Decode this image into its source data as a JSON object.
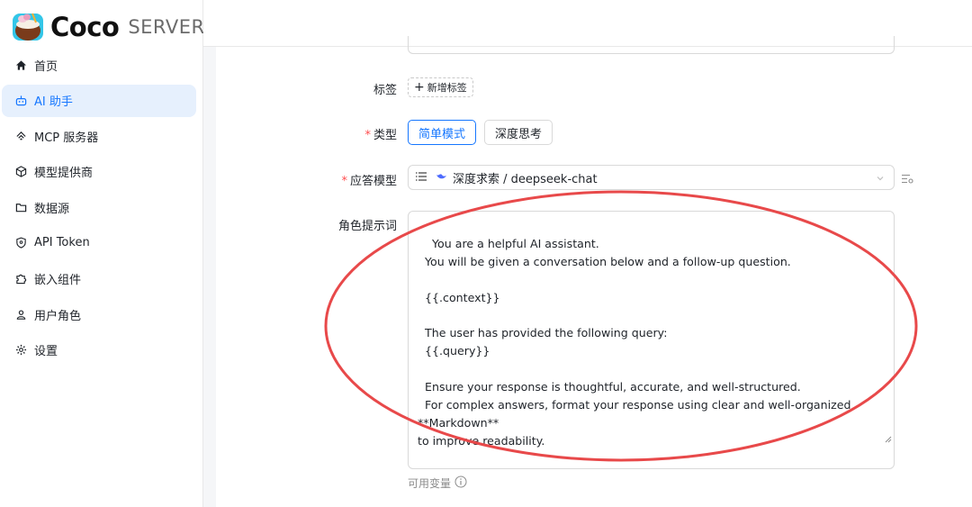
{
  "brand": {
    "name": "Coco",
    "suffix": "SERVER"
  },
  "sidebar": {
    "items": [
      {
        "label": "首页",
        "icon": "home-icon"
      },
      {
        "label": "AI 助手",
        "icon": "robot-icon",
        "active": true
      },
      {
        "label": "MCP 服务器",
        "icon": "mcp-icon"
      },
      {
        "label": "模型提供商",
        "icon": "model-provider-icon"
      },
      {
        "label": "数据源",
        "icon": "folder-icon"
      },
      {
        "label": "API Token",
        "icon": "shield-icon"
      },
      {
        "label": "嵌入组件",
        "icon": "puzzle-icon"
      },
      {
        "label": "用户角色",
        "icon": "user-icon"
      },
      {
        "label": "设置",
        "icon": "gear-icon"
      }
    ]
  },
  "form": {
    "tags": {
      "label": "标签",
      "add_label": "新增标签"
    },
    "type": {
      "label": "类型",
      "required_mark": "*",
      "options": [
        "简单模式",
        "深度思考"
      ],
      "selected": "简单模式"
    },
    "model": {
      "label": "应答模型",
      "required_mark": "*",
      "value": "深度求索 / deepseek-chat"
    },
    "prompt": {
      "label": "角色提示词",
      "value": "You are a helpful AI assistant.\n  You will be given a conversation below and a follow-up question.\n\n  {{.context}}\n\n  The user has provided the following query:\n  {{.query}}\n\n  Ensure your response is thoughtful, accurate, and well-structured.\n  For complex answers, format your response using clear and well-organized **Markdown**\nto improve readability.",
      "hint": "可用变量"
    }
  },
  "colors": {
    "accent": "#1677ff",
    "active_bg": "#e6f0fd",
    "required": "#ff4d4f",
    "annotation": "#e8494a"
  }
}
